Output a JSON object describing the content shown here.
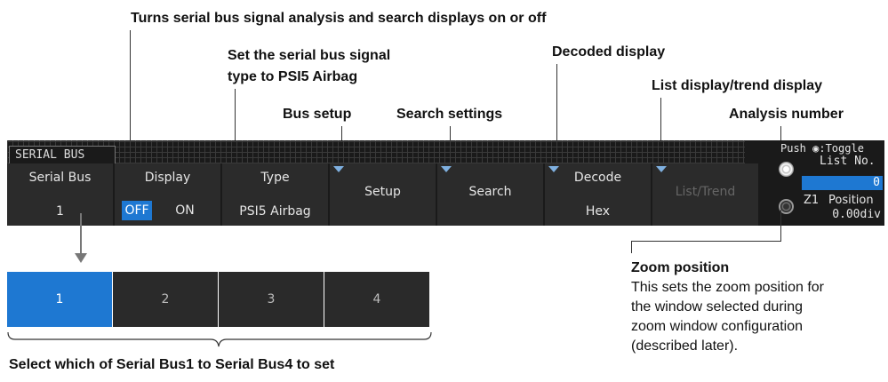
{
  "annotations": {
    "display_toggle": "Turns serial bus signal analysis and search displays on or off",
    "type_line1": "Set the serial bus signal",
    "type_line2": "type to PSI5 Airbag",
    "decoded": "Decoded display",
    "list_trend": "List display/trend display",
    "bus_setup": "Bus setup",
    "search_settings": "Search settings",
    "analysis_number": "Analysis number",
    "zoom_title": "Zoom position",
    "zoom_desc": [
      "This sets the zoom position for",
      "the window selected during",
      "zoom window configuration",
      "(described later)."
    ],
    "select_bus": "Select which of Serial Bus1 to Serial Bus4 to set"
  },
  "menu": {
    "title": "SERIAL BUS",
    "serial_bus": {
      "label": "Serial Bus",
      "value": "1"
    },
    "display": {
      "label": "Display",
      "off": "OFF",
      "on": "ON",
      "selected": "OFF"
    },
    "type": {
      "label": "Type",
      "value": "PSI5 Airbag"
    },
    "setup": {
      "label": "Setup"
    },
    "search": {
      "label": "Search"
    },
    "decode": {
      "label": "Decode",
      "value": "Hex"
    },
    "list_trend": {
      "label": "List/Trend",
      "enabled": false
    },
    "right": {
      "push_toggle": "Push ◉:Toggle",
      "list_no_label": "List No.",
      "list_no_value": "0",
      "position_label": "Position",
      "zoom_label": "Z1",
      "position_value": "0.00div"
    }
  },
  "selector": {
    "options": [
      "1",
      "2",
      "3",
      "4"
    ],
    "selected": "1"
  },
  "colors": {
    "accent": "#1e78d2",
    "panel": "#2b2b2b",
    "background": "#1a1a1a"
  }
}
